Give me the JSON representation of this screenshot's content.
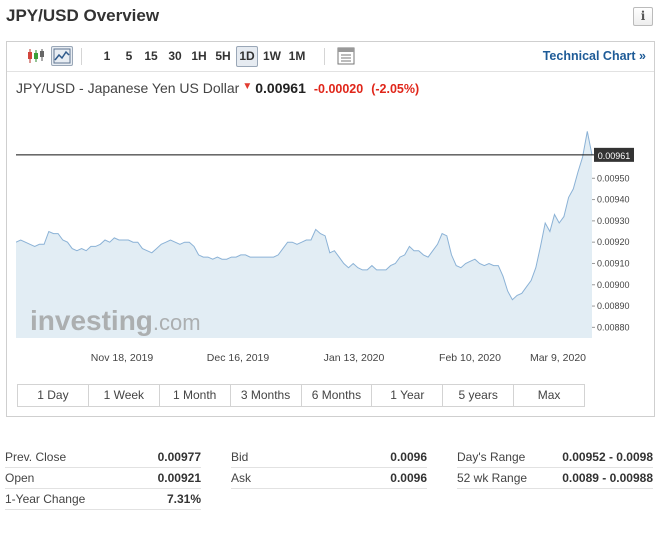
{
  "overview_title": "JPY/USD Overview",
  "info_icon": "info-icon",
  "toolbar": {
    "icons": [
      "candlestick-icon",
      "area-chart-icon",
      "table-icon"
    ],
    "periods": [
      "1",
      "5",
      "15",
      "30",
      "1H",
      "5H",
      "1D",
      "1W",
      "1M"
    ],
    "active_period": "1D",
    "technical_chart_link": "Technical Chart »"
  },
  "quote": {
    "name": "JPY/USD - Japanese Yen US Dollar",
    "direction": "down",
    "last": "0.00961",
    "change": "-0.00020",
    "change_pct": "(-2.05%)",
    "colors": {
      "down": "#e0261a"
    }
  },
  "chart_data": {
    "type": "area",
    "x_tick_labels": [
      "Nov 18, 2019",
      "Dec 16, 2019",
      "Jan 13, 2020",
      "Feb 10, 2020",
      "Mar 9, 2020"
    ],
    "y_ticks": [
      0.0088,
      0.0089,
      0.009,
      0.0091,
      0.0092,
      0.0093,
      0.0094,
      0.0095
    ],
    "ylim": [
      0.00875,
      0.00983
    ],
    "price_marker": "0.00961",
    "watermark": {
      "brand": "investing",
      "domain": ".com"
    },
    "colors": {
      "fill": "#e2edf4",
      "line": "#8bb2d6",
      "price_line": "#111111"
    },
    "values": [
      0.0092,
      0.00921,
      0.0092,
      0.00919,
      0.00918,
      0.00919,
      0.00919,
      0.00925,
      0.00924,
      0.00924,
      0.00921,
      0.0092,
      0.00917,
      0.00916,
      0.00917,
      0.00916,
      0.00918,
      0.00918,
      0.00919,
      0.00921,
      0.0092,
      0.00922,
      0.00921,
      0.00921,
      0.00921,
      0.0092,
      0.0092,
      0.00917,
      0.00916,
      0.00915,
      0.00917,
      0.00919,
      0.0092,
      0.00921,
      0.0092,
      0.00919,
      0.0092,
      0.0092,
      0.00918,
      0.00914,
      0.00913,
      0.00913,
      0.00912,
      0.00913,
      0.00912,
      0.00912,
      0.00913,
      0.00913,
      0.00914,
      0.00914,
      0.00913,
      0.00913,
      0.00913,
      0.00913,
      0.00913,
      0.00913,
      0.00914,
      0.00917,
      0.0092,
      0.0092,
      0.00919,
      0.0092,
      0.00921,
      0.00921,
      0.00926,
      0.00924,
      0.00923,
      0.00915,
      0.00916,
      0.00913,
      0.0091,
      0.00908,
      0.0091,
      0.00908,
      0.00907,
      0.00907,
      0.00909,
      0.00907,
      0.00907,
      0.00907,
      0.00909,
      0.0091,
      0.00913,
      0.00914,
      0.00918,
      0.00916,
      0.00916,
      0.00914,
      0.00913,
      0.00916,
      0.00919,
      0.00924,
      0.00923,
      0.00914,
      0.00909,
      0.00908,
      0.0091,
      0.00911,
      0.00912,
      0.0091,
      0.00909,
      0.0091,
      0.00909,
      0.00909,
      0.00904,
      0.00897,
      0.00893,
      0.00895,
      0.00896,
      0.00899,
      0.00902,
      0.00908,
      0.00918,
      0.00929,
      0.00925,
      0.00933,
      0.00929,
      0.00932,
      0.00941,
      0.00945,
      0.00953,
      0.0096,
      0.00972,
      0.00961
    ]
  },
  "range_buttons": [
    "1 Day",
    "1 Week",
    "1 Month",
    "3 Months",
    "6 Months",
    "1 Year",
    "5 years",
    "Max"
  ],
  "stats": {
    "col1": [
      {
        "label": "Prev. Close",
        "value": "0.00977"
      },
      {
        "label": "Open",
        "value": "0.00921"
      },
      {
        "label": "1-Year Change",
        "value": "7.31%"
      }
    ],
    "col2": [
      {
        "label": "Bid",
        "value": "0.0096"
      },
      {
        "label": "Ask",
        "value": "0.0096"
      }
    ],
    "col3": [
      {
        "label": "Day's Range",
        "value": "0.00952 - 0.0098"
      },
      {
        "label": "52 wk Range",
        "value": "0.0089 - 0.00988"
      }
    ]
  }
}
